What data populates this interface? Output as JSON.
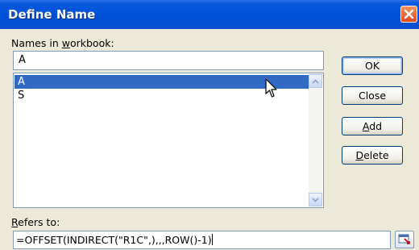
{
  "dialog": {
    "title": "Define Name",
    "names_label_prefix": "Names in ",
    "names_label_accel": "w",
    "names_label_suffix": "orkbook:",
    "name_input_value": "A",
    "names": [
      {
        "label": "A",
        "selected": true
      },
      {
        "label": "S",
        "selected": false
      }
    ],
    "buttons": {
      "ok": "OK",
      "close": "Close",
      "add_accel": "A",
      "add_rest": "dd",
      "delete_accel": "D",
      "delete_rest": "elete"
    },
    "refers_label_accel": "R",
    "refers_label_rest": "efers to:",
    "refers_value": "=OFFSET(INDIRECT(\"R1C\",),,,ROW()-1)"
  },
  "icons": {
    "close": "close-icon",
    "scroll_up": "scroll-up-arrow-icon",
    "scroll_down": "scroll-down-arrow-icon",
    "collapse": "collapse-dialog-icon",
    "cursor": "mouse-pointer-icon"
  }
}
